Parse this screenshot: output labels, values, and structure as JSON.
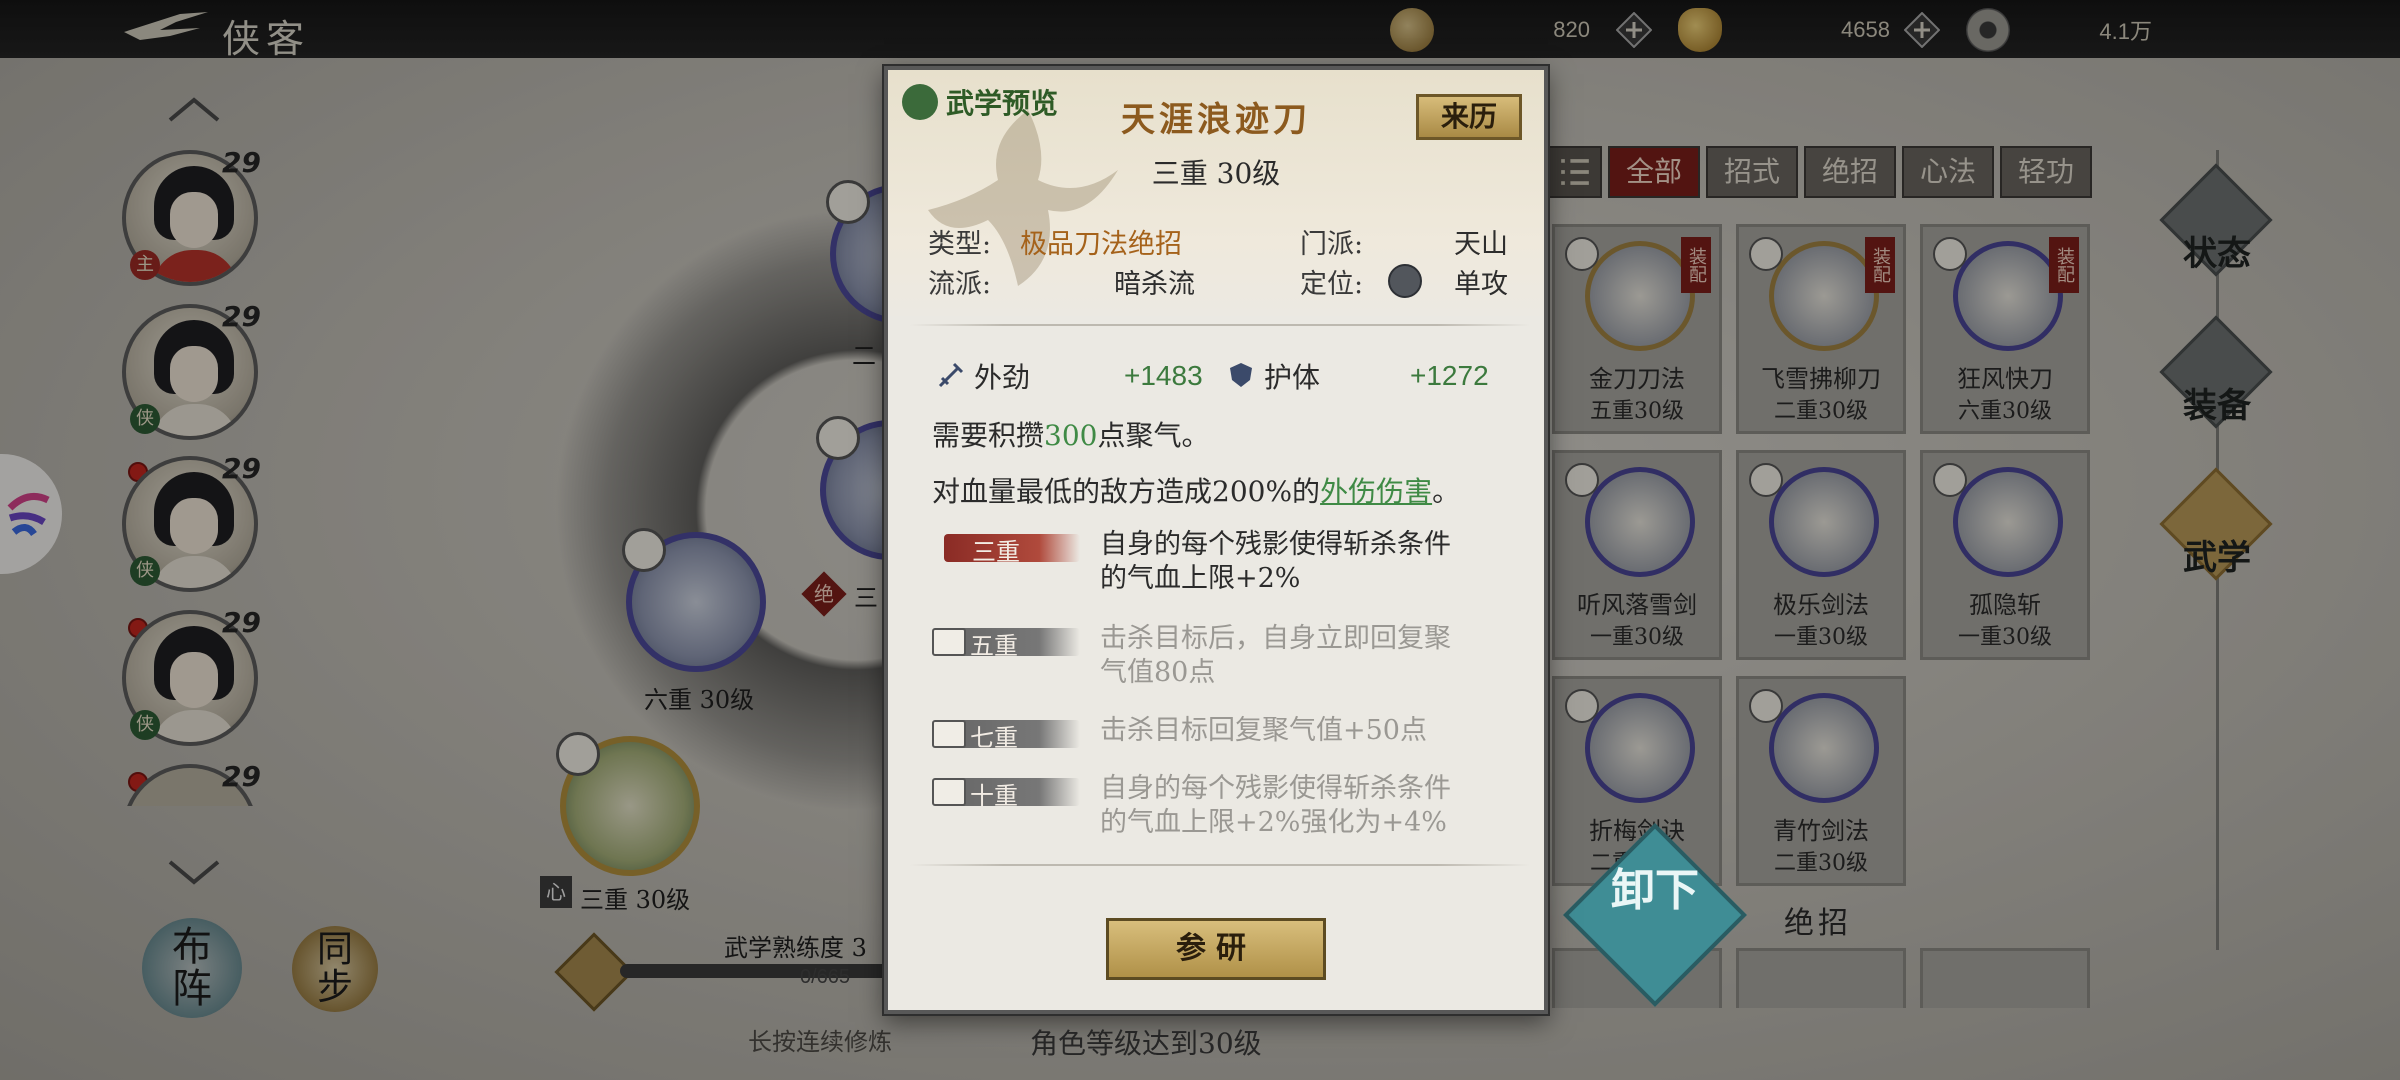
{
  "topbar": {
    "title": "侠客",
    "currencies": [
      {
        "icon": "jade-leaf-icon",
        "value": "820"
      },
      {
        "icon": "gold-ingot-icon",
        "value": "4658"
      },
      {
        "icon": "copper-coin-icon",
        "value": "4.1万"
      }
    ]
  },
  "roster": {
    "characters": [
      {
        "level": "29",
        "badge": "主"
      },
      {
        "level": "29",
        "badge": "侠"
      },
      {
        "level": "29",
        "badge": "侠"
      },
      {
        "level": "29",
        "badge": "侠"
      },
      {
        "level": "29",
        "badge": ""
      }
    ],
    "bottom_buttons": {
      "formation": "布阵",
      "sync": "同步"
    }
  },
  "skill_tree": {
    "nodes": [
      {
        "label": "六重 30级"
      },
      {
        "label": "三重 30级",
        "tag": "心"
      }
    ],
    "partial_labels": {
      "node_top": "二",
      "node_mid": "三",
      "node_mid_tag": "绝"
    },
    "proficiency": {
      "title": "武学熟练度 3",
      "value": "0/665",
      "percent": 0
    },
    "hold_hint": "长按连续修炼"
  },
  "filters": [
    "全部",
    "招式",
    "绝招",
    "心法",
    "轻功"
  ],
  "skill_cards": [
    {
      "name": "金刀刀法",
      "level": "五重30级",
      "equipped": "装配",
      "ring": "gold"
    },
    {
      "name": "飞雪拂柳刀",
      "level": "二重30级",
      "equipped": "装配",
      "ring": "gold"
    },
    {
      "name": "狂风快刀",
      "level": "六重30级",
      "equipped": "装配",
      "ring": "purple"
    },
    {
      "name": "听风落雪剑",
      "level": "一重30级",
      "equipped": "",
      "ring": "purple"
    },
    {
      "name": "极乐剑法",
      "level": "一重30级",
      "equipped": "",
      "ring": "purple"
    },
    {
      "name": "孤隐斩",
      "level": "一重30级",
      "equipped": "",
      "ring": "purple"
    },
    {
      "name": "折梅剑诀",
      "level": "二重30级",
      "equipped": "",
      "ring": "purple"
    },
    {
      "name": "青竹剑法",
      "level": "二重30级",
      "equipped": "",
      "ring": "purple"
    }
  ],
  "section_label": "绝招",
  "unequip_label": "卸下",
  "right_menu": [
    "状态",
    "装备",
    "武学"
  ],
  "panel": {
    "preview_tag": "武学预览",
    "title": "天涯浪迹刀",
    "tier": "三重 30级",
    "origin_button": "来历",
    "attributes": {
      "type_label": "类型:",
      "type_value": "极品刀法绝招",
      "sect_label": "门派:",
      "sect_value": "天山",
      "school_label": "流派:",
      "school_value": "暗杀流",
      "role_label": "定位:",
      "role_value": "单攻"
    },
    "stats": [
      {
        "name": "外劲",
        "value": "+1483",
        "icon": "sword-icon"
      },
      {
        "name": "护体",
        "value": "+1272",
        "icon": "shield-icon"
      }
    ],
    "need": {
      "prefix": "需要积攒",
      "amount": "300",
      "suffix": "点聚气。"
    },
    "effect": {
      "prefix": "对血量最低的敌方造成200%的",
      "link": "外伤伤害",
      "suffix": "。"
    },
    "tiers": [
      {
        "label": "三重",
        "active": true,
        "line1": "自身的每个残影使得斩杀条件",
        "line2": "的气血上限+2%"
      },
      {
        "label": "五重",
        "active": false,
        "line1": "击杀目标后，自身立即回复聚",
        "line2": "气值80点"
      },
      {
        "label": "七重",
        "active": false,
        "line1": "击杀目标回复聚气值+50点",
        "line2": ""
      },
      {
        "label": "十重",
        "active": false,
        "line1": "自身的每个残影使得斩杀条件",
        "line2": "的气血上限+2%强化为+4%"
      }
    ],
    "study_button": "参研",
    "requirement": "角色等级达到30级"
  }
}
